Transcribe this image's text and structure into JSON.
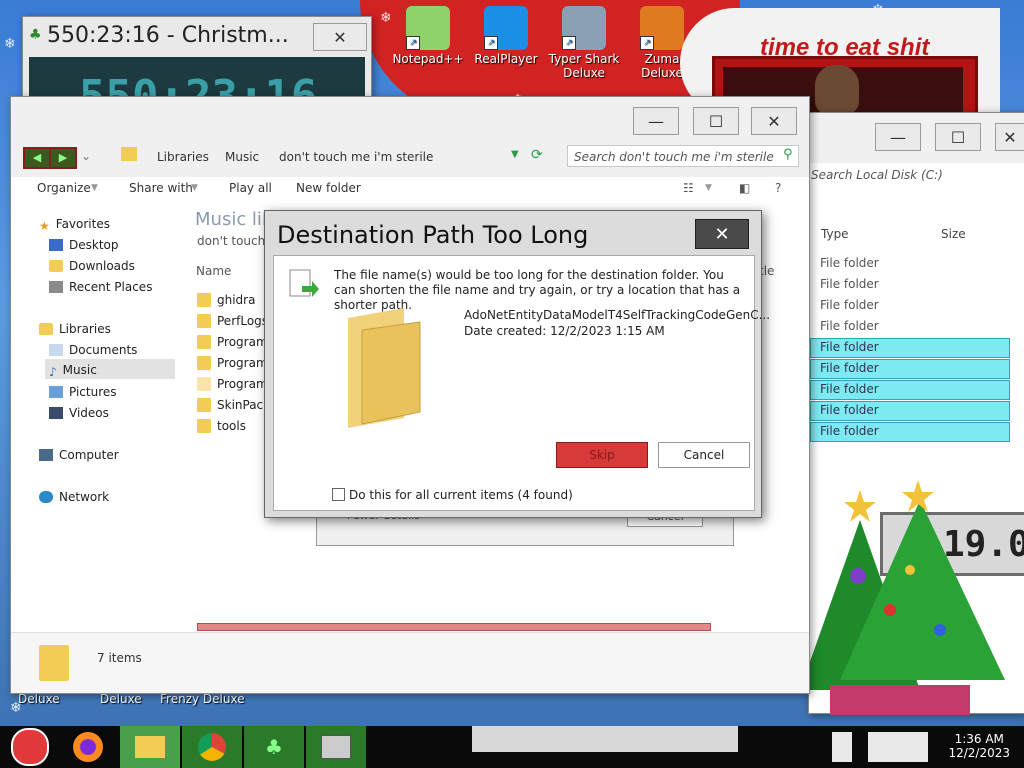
{
  "desktop": {
    "icons": [
      {
        "label": "Notepad++"
      },
      {
        "label": "RealPlayer"
      },
      {
        "label": "Typer Shark Deluxe"
      },
      {
        "label": "Zuma Deluxe"
      }
    ],
    "poster_text": "time to eat shit",
    "bottom_labels": [
      "Deluxe",
      "Deluxe",
      "Frenzy Deluxe"
    ],
    "clock_widget": "19.0"
  },
  "timer_window": {
    "title": "550:23:16 - Christm...",
    "display": "550:23:16",
    "close_glyph": "✕"
  },
  "disk_window": {
    "search_placeholder": "Search Local Disk (C:)",
    "col_type": "Type",
    "col_size": "Size",
    "rows": [
      "File folder",
      "File folder",
      "File folder",
      "File folder",
      "File folder",
      "File folder",
      "File folder",
      "File folder",
      "File folder"
    ]
  },
  "explorer": {
    "breadcrumb": [
      "Libraries",
      "Music",
      "don't touch me i'm sterile"
    ],
    "search_placeholder": "Search don't touch me i'm sterile",
    "toolbar": {
      "organize": "Organize",
      "share": "Share with",
      "play": "Play all",
      "new_folder": "New folder"
    },
    "header_title": "Music lil",
    "header_sub": "don't touch",
    "col_name": "Name",
    "col_title": "tle",
    "nav": {
      "favorites": "Favorites",
      "desktop": "Desktop",
      "downloads": "Downloads",
      "recent": "Recent Places",
      "libraries": "Libraries",
      "documents": "Documents",
      "music": "Music",
      "pictures": "Pictures",
      "videos": "Videos",
      "computer": "Computer",
      "network": "Network"
    },
    "files": [
      "ghidra",
      "PerfLogs",
      "Program",
      "Program",
      "Program",
      "SkinPack",
      "tools"
    ],
    "status": "7 items"
  },
  "behind_dialog": {
    "fewer_details": "Fewer details",
    "cancel": "Cancel"
  },
  "dialog": {
    "title": "Destination Path Too Long",
    "message": "The file name(s) would be too long for the destination folder.  You can shorten the file name and try again, or try a location that has a shorter path.",
    "file_name": "AdoNetEntityDataModelT4SelfTrackingCodeGenC...",
    "date_created": "Date created: 12/2/2023 1:15 AM",
    "skip": "Skip",
    "cancel": "Cancel",
    "checkbox": "Do this for all current items (4 found)"
  },
  "taskbar": {
    "time": "1:36 AM",
    "date": "12/2/2023"
  },
  "colors": {
    "santa_red": "#d22323",
    "cyan_highlight": "#7de9f0",
    "skip_red": "#d83a3a"
  }
}
